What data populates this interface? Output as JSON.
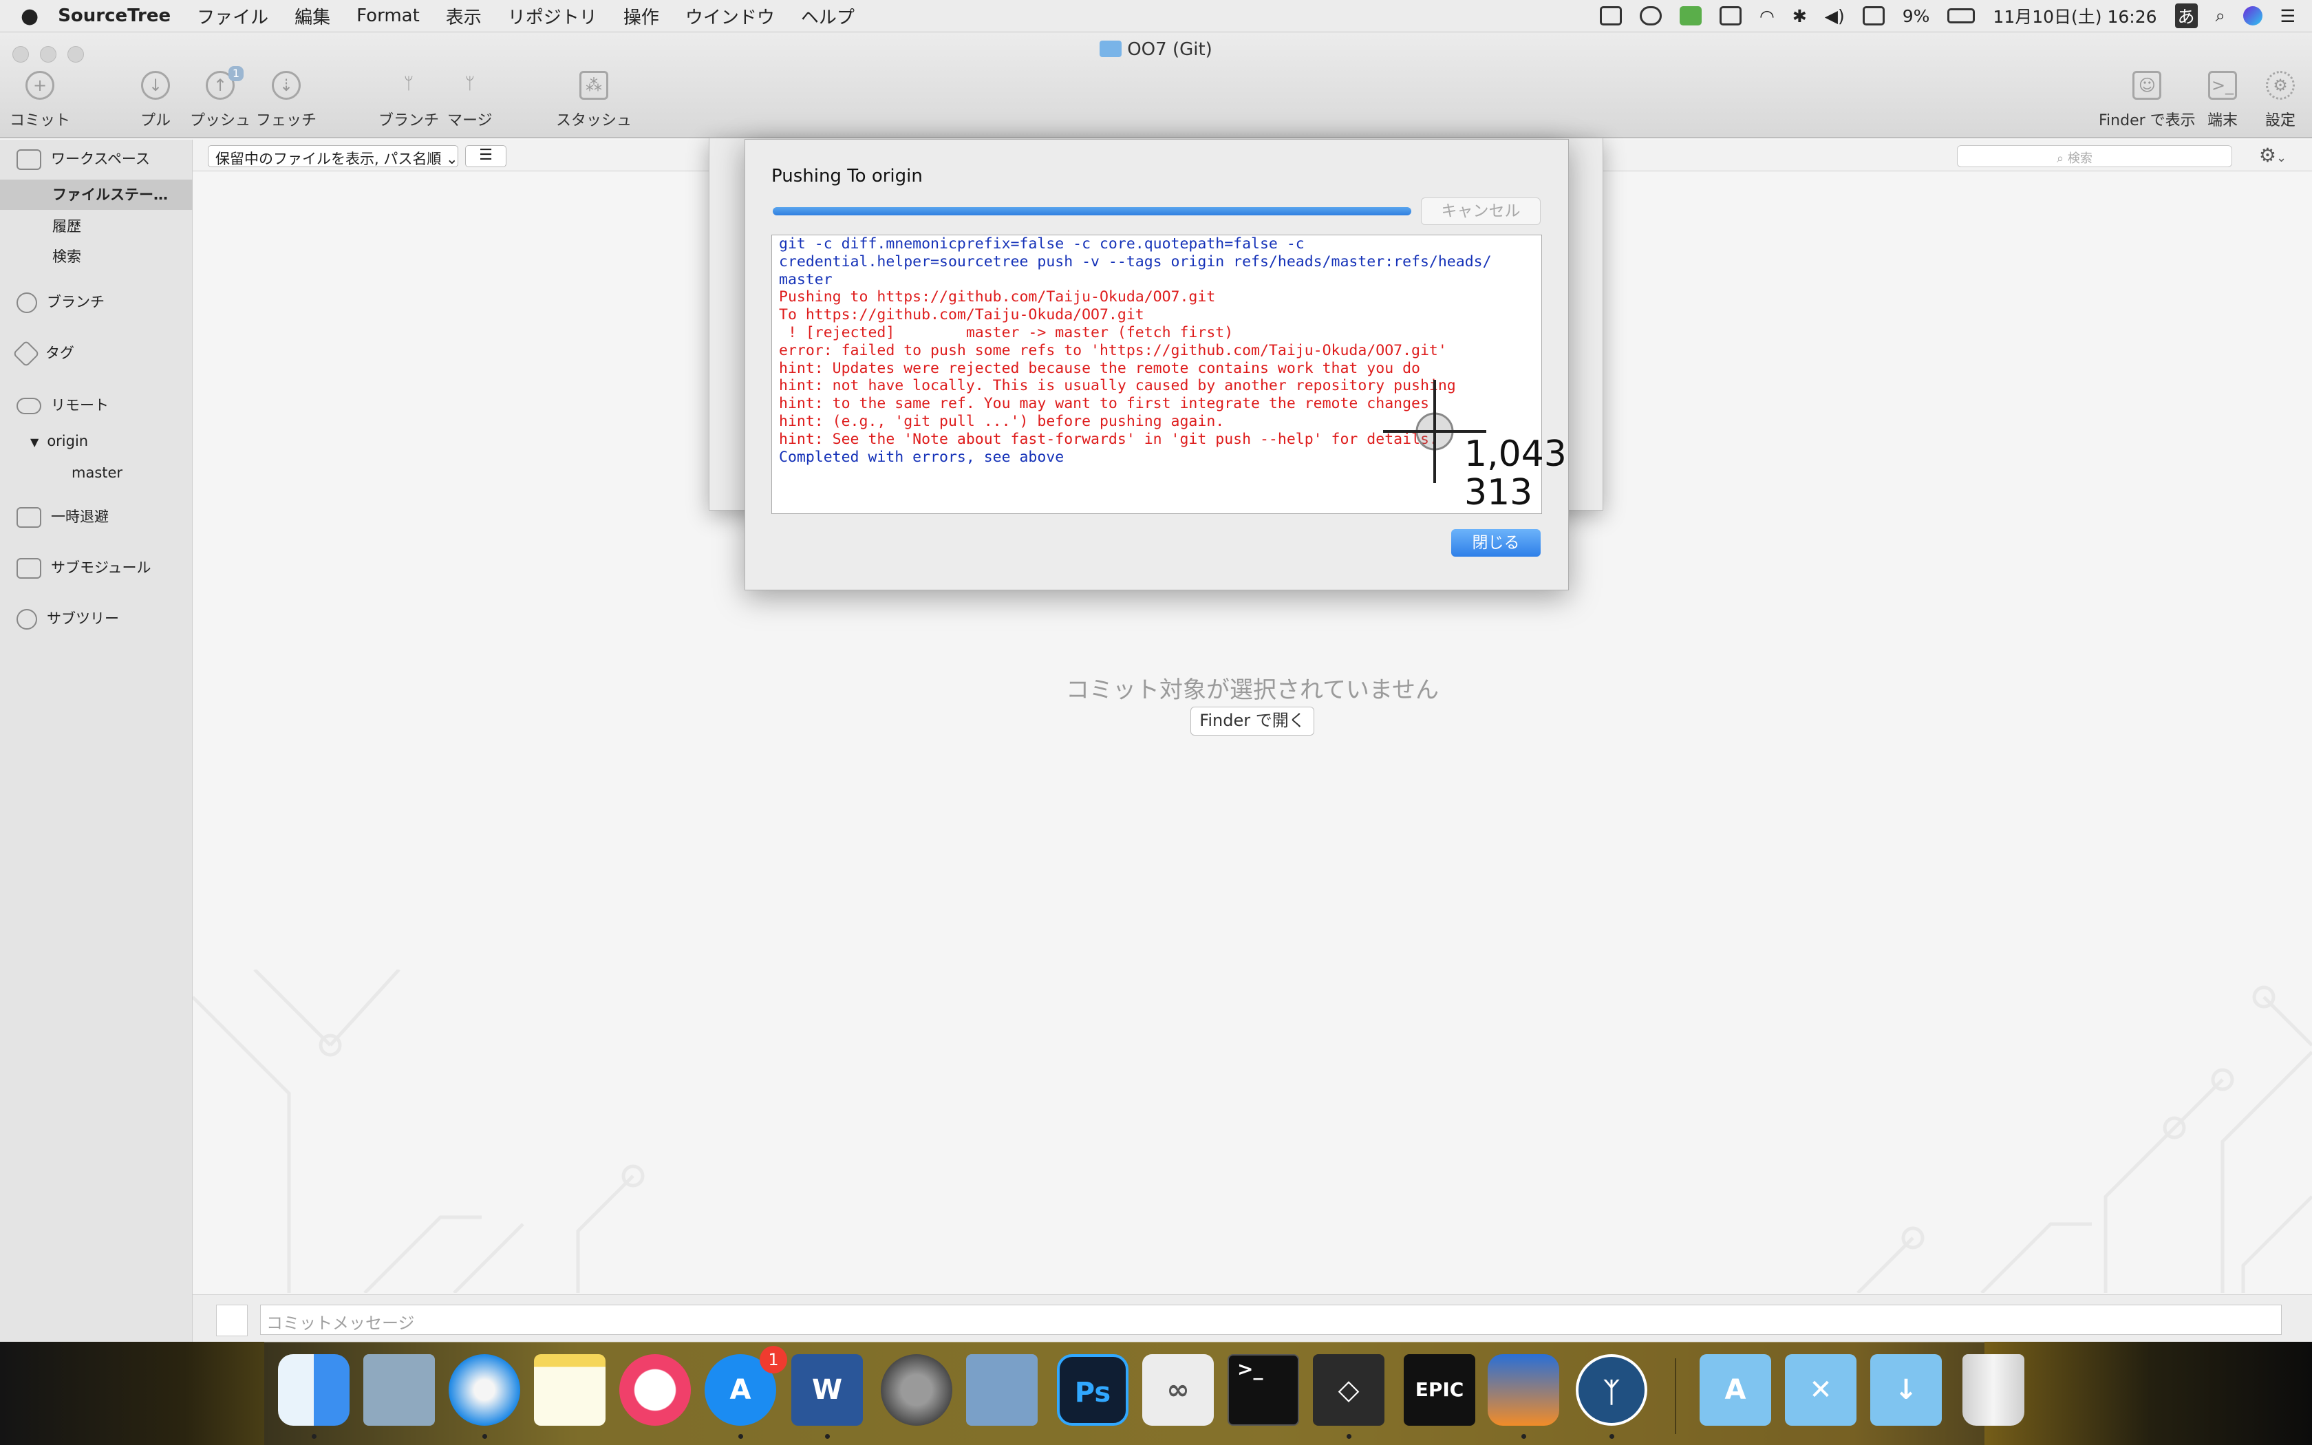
{
  "menubar": {
    "app": "SourceTree",
    "items": [
      "ファイル",
      "編集",
      "Format",
      "表示",
      "リポジトリ",
      "操作",
      "ウインドウ",
      "ヘルプ"
    ],
    "battery": "9%",
    "datetime": "11月10日(土)  16:26",
    "ime": "あ"
  },
  "window": {
    "title": "OO7 (Git)"
  },
  "toolbar": {
    "commit": "コミット",
    "pull": "プル",
    "push": "プッシュ",
    "push_badge": "1",
    "fetch": "フェッチ",
    "branch": "ブランチ",
    "merge": "マージ",
    "stash": "スタッシュ",
    "show_in_finder": "Finder で表示",
    "terminal": "端末",
    "settings": "設定"
  },
  "filter": {
    "select": "保留中のファイルを表示, パス名順",
    "search_placeholder": "検索"
  },
  "sidebar": {
    "workspace": "ワークスペース",
    "file_status": "ファイルステー…",
    "history": "履歴",
    "search": "検索",
    "branches": "ブランチ",
    "tags": "タグ",
    "remotes": "リモート",
    "origin": "origin",
    "master": "master",
    "stashes": "一時退避",
    "submodules": "サブモジュール",
    "subtrees": "サブツリー"
  },
  "main": {
    "empty_message": "コミット対象が選択されていません",
    "open_finder": "Finder で開く"
  },
  "commit_bar": {
    "placeholder": "コミットメッセージ"
  },
  "dialog": {
    "title": "Pushing To origin",
    "progress": 1.0,
    "cancel": "キャンセル",
    "close": "閉じる",
    "log": [
      {
        "t": "git -c diff.mnemonicprefix=false -c core.quotepath=false -c",
        "c": "b"
      },
      {
        "t": "credential.helper=sourcetree push -v --tags origin refs/heads/master:refs/heads/",
        "c": "b"
      },
      {
        "t": "master",
        "c": "b"
      },
      {
        "t": "Pushing to https://github.com/Taiju-Okuda/OO7.git",
        "c": "r"
      },
      {
        "t": "To https://github.com/Taiju-Okuda/OO7.git",
        "c": "r"
      },
      {
        "t": " ! [rejected]        master -> master (fetch first)",
        "c": "r"
      },
      {
        "t": "error: failed to push some refs to 'https://github.com/Taiju-Okuda/OO7.git'",
        "c": "r"
      },
      {
        "t": "hint: Updates were rejected because the remote contains work that you do",
        "c": "r"
      },
      {
        "t": "hint: not have locally. This is usually caused by another repository pushing",
        "c": "r"
      },
      {
        "t": "hint: to the same ref. You may want to first integrate the remote changes",
        "c": "r"
      },
      {
        "t": "hint: (e.g., 'git pull ...') before pushing again.",
        "c": "r"
      },
      {
        "t": "hint: See the 'Note about fast-forwards' in 'git push --help' for details.",
        "c": "r"
      },
      {
        "t": "Completed with errors, see above",
        "c": "b"
      }
    ]
  },
  "crosshair": {
    "x": "1,043",
    "y": "313"
  },
  "dock": {
    "appstore_badge": "1",
    "photoshop": "Ps",
    "word": "W",
    "epic": "EPIC",
    "terminal": ">_",
    "colors": {
      "finder": "#3b8ff0",
      "safari": "#1e88e5",
      "music": "#f0406a",
      "appstore": "#1b8cf2",
      "photoshop": "#0f1e33",
      "folder": "#7fc4f0"
    }
  }
}
